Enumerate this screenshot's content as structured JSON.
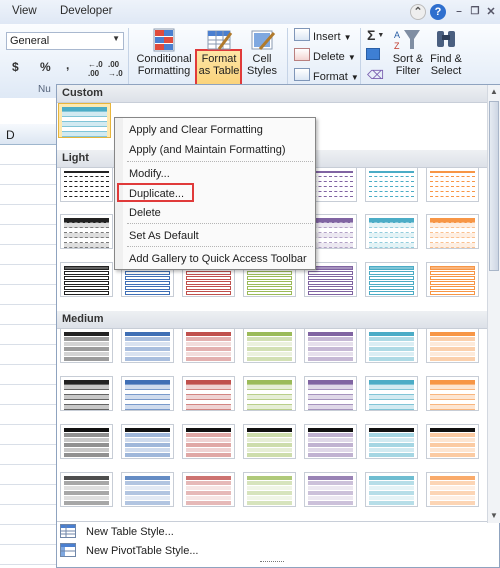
{
  "ribbon": {
    "tabs": [
      "View",
      "Developer"
    ],
    "number_format": "General",
    "number_buttons": [
      "$",
      "%",
      ","
    ],
    "group_label_number": "Nu",
    "conditional_formatting": [
      "Conditional",
      "Formatting"
    ],
    "format_as_table": [
      "Format",
      "as Table"
    ],
    "cell_styles": [
      "Cell",
      "Styles"
    ],
    "insert": "Insert",
    "delete": "Delete",
    "format": "Format",
    "sort_filter": [
      "Sort &",
      "Filter"
    ],
    "find_select": [
      "Find &",
      "Select"
    ],
    "help": "?"
  },
  "sheet": {
    "column": "D"
  },
  "gallery": {
    "sections": {
      "custom": "Custom",
      "light": "Light",
      "medium": "Medium"
    },
    "commands": [
      "New Table Style...",
      "New PivotTable Style..."
    ],
    "style_colors": [
      "#222222",
      "#3f6fb5",
      "#c0504d",
      "#9bbb59",
      "#8064a2",
      "#4bacc6",
      "#f79646"
    ]
  },
  "context_menu": {
    "items": [
      "Apply and Clear Formatting",
      "Apply (and Maintain Formatting)",
      "Modify...",
      "Duplicate...",
      "Delete",
      "Set As Default",
      "Add Gallery to Quick Access Toolbar"
    ]
  }
}
